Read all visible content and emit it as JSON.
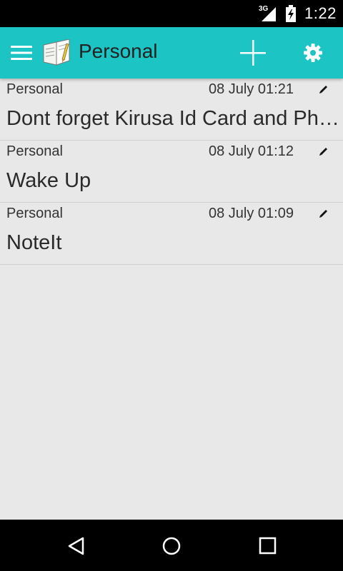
{
  "status_bar": {
    "network": "3G",
    "time": "1:22"
  },
  "app_bar": {
    "title": "Personal",
    "accent_color": "#1cc4c4"
  },
  "notes": [
    {
      "category": "Personal",
      "date": "08 July 01:21",
      "title": "Dont forget Kirusa Id Card and Ph…"
    },
    {
      "category": "Personal",
      "date": "08 July 01:12",
      "title": "Wake Up"
    },
    {
      "category": "Personal",
      "date": "08 July 01:09",
      "title": "NoteIt"
    }
  ],
  "icons": {
    "menu": "hamburger-menu-icon",
    "logo": "notes-app-logo",
    "add": "plus-icon",
    "settings": "gear-icon",
    "edit": "pencil-icon",
    "back": "back-triangle-icon",
    "home": "home-circle-icon",
    "recents": "recents-square-icon"
  }
}
